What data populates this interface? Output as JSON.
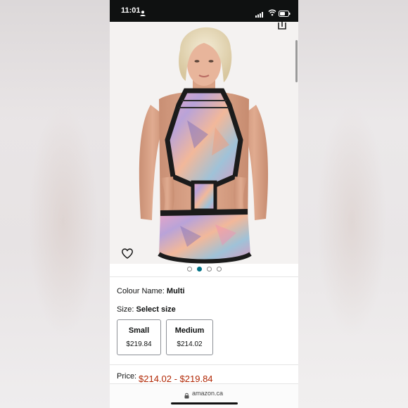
{
  "status_bar": {
    "time": "11:01"
  },
  "product": {
    "colour_label": "Colour Name:",
    "colour_value": "Multi",
    "size_label": "Size:",
    "size_value": "Select size",
    "size_options": [
      {
        "name": "Small",
        "price": "$219.84"
      },
      {
        "name": "Medium",
        "price": "$214.02"
      }
    ],
    "price_label": "Price:",
    "price_value": "$214.02 - $219.84"
  },
  "gallery": {
    "image_count": 4,
    "active_index": 1
  },
  "browser": {
    "url": "amazon.ca"
  },
  "colors": {
    "price": "#b12704",
    "active_dot": "#007185",
    "status_bar": "#0f1111"
  },
  "icons": [
    "person-icon",
    "signal-icon",
    "wifi-icon",
    "battery-icon",
    "share-icon",
    "heart-icon",
    "lock-icon"
  ]
}
